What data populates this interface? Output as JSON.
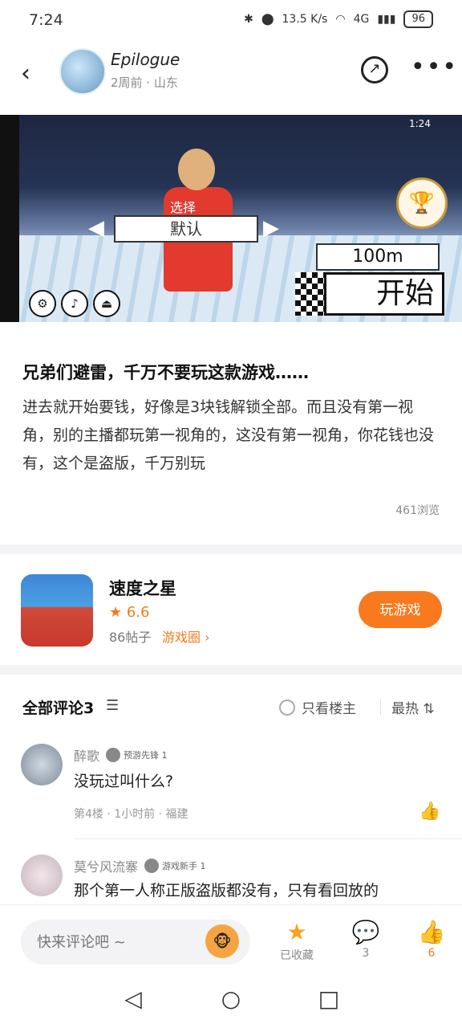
{
  "status_bar": {
    "time": "7:24",
    "net_speed": "13.5 K/s",
    "signal": "4G",
    "battery": "96"
  },
  "header": {
    "author": "Epilogue",
    "meta": "2周前 · 山东"
  },
  "hero_game": {
    "select_label": "选择",
    "select_value": "默认",
    "distance": "100m",
    "start_label": "开始",
    "hud_time": "1:24"
  },
  "post": {
    "title": "兄弟们避雷，千万不要玩这款游戏……",
    "body": "进去就开始要钱，好像是3块钱解锁全部。而且没有第一视角，别的主播都玩第一视角的，这没有第一视角，你花钱也没有，这个是盗版，千万别玩",
    "views": "461浏览"
  },
  "game_card": {
    "name": "速度之星",
    "rating": "6.6",
    "posts": "86帖子",
    "circle_link": "游戏圈",
    "play_button": "玩游戏",
    "accent_color": "#f8791e"
  },
  "comments_section": {
    "title": "全部评论3",
    "only_owner": "只看楼主",
    "sort": "最热"
  },
  "comments": [
    {
      "name": "醉歌",
      "badge": "预游先锋 1",
      "text": "没玩过叫什么?",
      "meta": "第4楼 · 1小时前 · 福建"
    },
    {
      "name": "莫兮风流寨",
      "badge": "游戏新手 1",
      "text": "那个第一人称正版盗版都没有，只有看回放的"
    }
  ],
  "bottom_bar": {
    "input_placeholder": "快来评论吧 ~",
    "collect_label": "已收藏",
    "comment_count": "3",
    "like_count": "6"
  }
}
